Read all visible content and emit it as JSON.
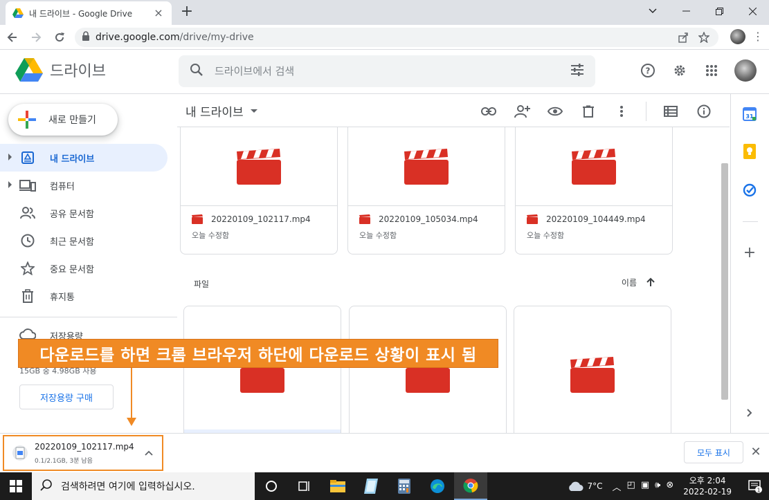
{
  "browser": {
    "tab_title": "내 드라이브 - Google Drive",
    "url_host": "drive.google.com",
    "url_path": "/drive/my-drive"
  },
  "drive": {
    "product_name": "드라이브",
    "search_placeholder": "드라이브에서 검색"
  },
  "sidebar": {
    "new_label": "새로 만들기",
    "items": [
      {
        "label": "내 드라이브",
        "icon": "my-drive-icon",
        "active": true,
        "expandable": true
      },
      {
        "label": "컴퓨터",
        "icon": "computer-icon",
        "active": false,
        "expandable": true
      },
      {
        "label": "공유 문서함",
        "icon": "shared-icon",
        "active": false,
        "expandable": false
      },
      {
        "label": "최근 문서함",
        "icon": "clock-icon",
        "active": false,
        "expandable": false
      },
      {
        "label": "중요 문서함",
        "icon": "star-icon",
        "active": false,
        "expandable": false
      },
      {
        "label": "휴지통",
        "icon": "trash-icon",
        "active": false,
        "expandable": false
      }
    ],
    "storage_title": "저장용량",
    "storage_usage": "15GB 중 4.98GB 사용",
    "buy_storage": "저장용량 구매"
  },
  "main": {
    "title": "내 드라이브",
    "files_label": "파일",
    "sort_label": "이름",
    "cards": [
      {
        "name": "20220109_102117.mp4",
        "modified": "오늘 수정함"
      },
      {
        "name": "20220109_105034.mp4",
        "modified": "오늘 수정함"
      },
      {
        "name": "20220109_104449.mp4",
        "modified": "오늘 수정함"
      }
    ]
  },
  "download": {
    "file_name": "20220109_102117.mp4",
    "status": "0.1/2.1GB, 3분 남음",
    "show_all": "모두 표시"
  },
  "annotation": {
    "text": "다운로드를 하면 크롬 브라우저 하단에 다운로드 상황이 표시 됨"
  },
  "taskbar": {
    "search_text": "검색하려면 여기에 입력하십시오.",
    "temperature": "7°C",
    "time": "오후 2:04",
    "date": "2022-02-19",
    "notification_count": "1"
  },
  "colors": {
    "accent": "#1a73e8",
    "annotation": "#f08a24",
    "video_red": "#d93025"
  }
}
